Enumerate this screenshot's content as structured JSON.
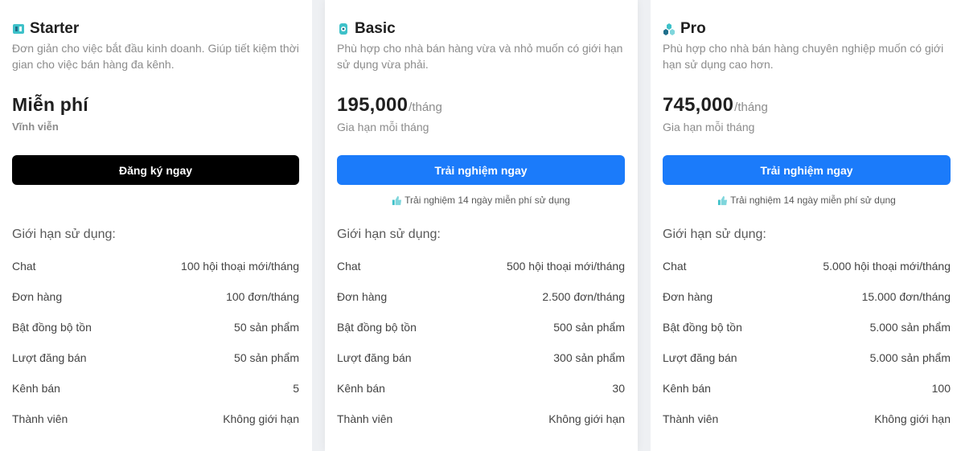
{
  "plans": [
    {
      "name": "Starter",
      "icon": "starter-shield-icon",
      "description": "Đơn giản cho việc bắt đầu kinh doanh. Giúp tiết kiệm thời gian cho việc bán hàng đa kênh.",
      "price": "Miễn phí",
      "per": "",
      "period": "Vĩnh viễn",
      "cta": "Đăng ký ngay",
      "trial_note": "",
      "limits_title": "Giới hạn sử dụng:",
      "limits": [
        {
          "label": "Chat",
          "value": "100 hội thoại mới/tháng"
        },
        {
          "label": "Đơn hàng",
          "value": "100 đơn/tháng"
        },
        {
          "label": "Bật đồng bộ tồn",
          "value": "50 sản phẩm"
        },
        {
          "label": "Lượt đăng bán",
          "value": "50 sản phẩm"
        },
        {
          "label": "Kênh bán",
          "value": "5"
        },
        {
          "label": "Thành viên",
          "value": "Không giới hạn"
        }
      ]
    },
    {
      "name": "Basic",
      "icon": "basic-lock-icon",
      "description": "Phù hợp cho nhà bán hàng vừa và nhỏ muốn có giới hạn sử dụng vừa phải.",
      "price": "195,000",
      "per": "/tháng",
      "period": "Gia hạn mỗi tháng",
      "cta": "Trải nghiệm ngay",
      "trial_note": "Trải nghiệm 14 ngày miễn phí sử dụng",
      "limits_title": "Giới hạn sử dụng:",
      "limits": [
        {
          "label": "Chat",
          "value": "500 hội thoại mới/tháng"
        },
        {
          "label": "Đơn hàng",
          "value": "2.500 đơn/tháng"
        },
        {
          "label": "Bật đồng bộ tồn",
          "value": "500 sản phẩm"
        },
        {
          "label": "Lượt đăng bán",
          "value": "300 sản phẩm"
        },
        {
          "label": "Kênh bán",
          "value": "30"
        },
        {
          "label": "Thành viên",
          "value": "Không giới hạn"
        }
      ]
    },
    {
      "name": "Pro",
      "icon": "pro-cubes-icon",
      "description": "Phù hợp cho nhà bán hàng chuyên nghiệp muốn có giới hạn sử dụng cao hơn.",
      "price": "745,000",
      "per": "/tháng",
      "period": "Gia hạn mỗi tháng",
      "cta": "Trải nghiệm ngay",
      "trial_note": "Trải nghiệm 14 ngày miễn phí sử dụng",
      "limits_title": "Giới hạn sử dụng:",
      "limits": [
        {
          "label": "Chat",
          "value": "5.000 hội thoại mới/tháng"
        },
        {
          "label": "Đơn hàng",
          "value": "15.000 đơn/tháng"
        },
        {
          "label": "Bật đồng bộ tồn",
          "value": "5.000 sản phẩm"
        },
        {
          "label": "Lượt đăng bán",
          "value": "5.000 sản phẩm"
        },
        {
          "label": "Kênh bán",
          "value": "100"
        },
        {
          "label": "Thành viên",
          "value": "Không giới hạn"
        }
      ]
    }
  ],
  "colors": {
    "accent_blue": "#1b7bfa",
    "starter_cta": "#000000",
    "icon_teal": "#3ec1c9"
  }
}
